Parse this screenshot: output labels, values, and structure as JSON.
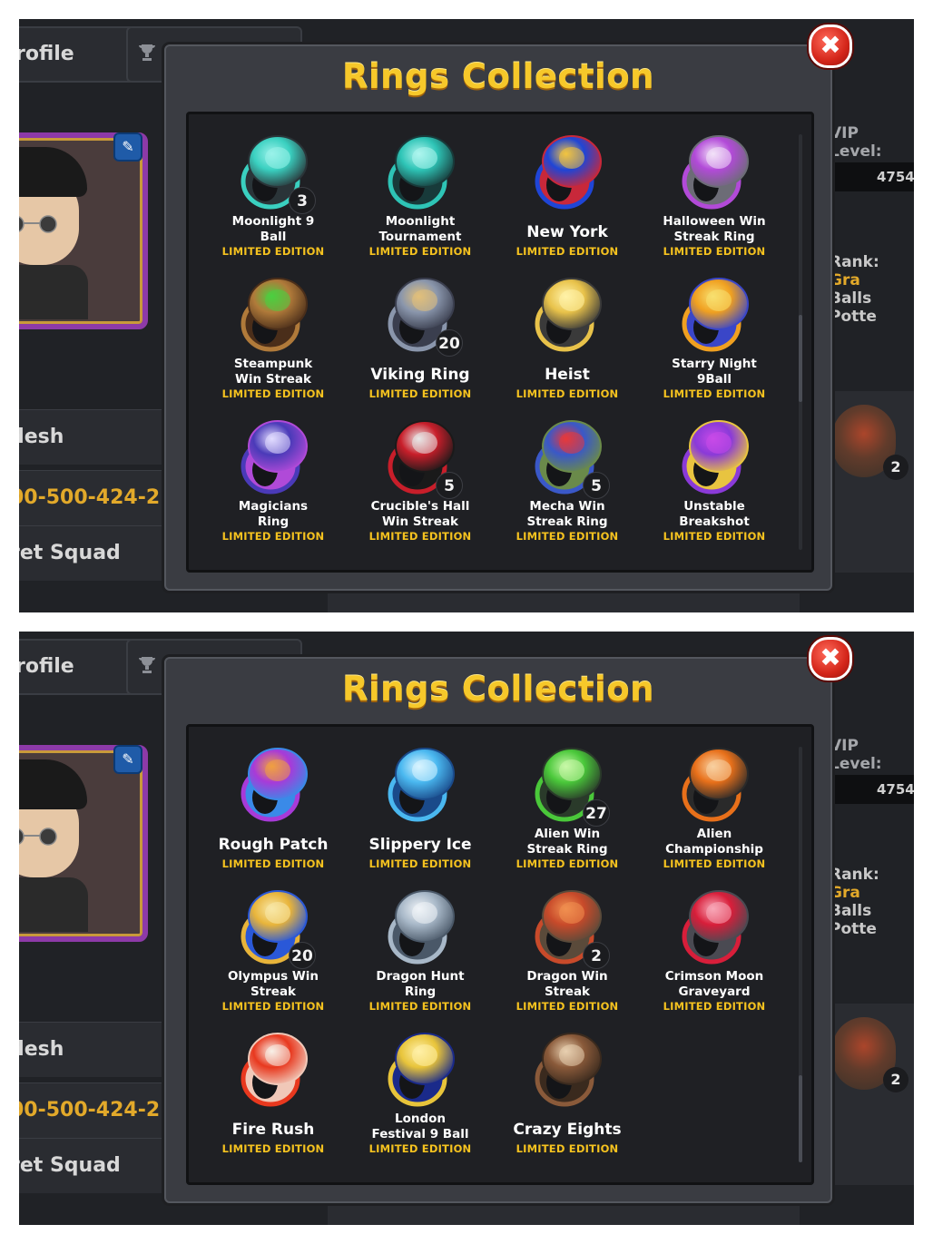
{
  "panels": [
    {
      "background": {
        "profile_tab": "rofile",
        "name": "desh",
        "id": "00-500-424-2",
        "squad": "ret Squad",
        "vip_label": "VIP Level:",
        "vip_value": "4754",
        "rank_label": "Rank:",
        "rank_value": "Gra",
        "balls_label": "Balls Potte",
        "side_ring_count": "2"
      },
      "modal": {
        "title": "Rings Collection",
        "close_icon": "close-icon",
        "scroll_position": 0.55
      },
      "rings": [
        {
          "name": "Moonlight 9 Ball",
          "lines": [
            "Moonlight 9",
            "Ball"
          ],
          "edition": "LIMITED EDITION",
          "count": "3",
          "colors": [
            "#3ad0c0",
            "#2a3438",
            "#9af2ea"
          ]
        },
        {
          "name": "Moonlight Tournament",
          "lines": [
            "Moonlight",
            "Tournament"
          ],
          "edition": "LIMITED EDITION",
          "count": "",
          "colors": [
            "#2ec4b6",
            "#183a3a",
            "#aef5ee"
          ]
        },
        {
          "name": "New York",
          "lines": [
            "New York"
          ],
          "edition": "LIMITED EDITION",
          "count": "",
          "colors": [
            "#1f45d6",
            "#c8283a",
            "#f2c440"
          ]
        },
        {
          "name": "Halloween Win Streak Ring",
          "lines": [
            "Halloween Win",
            "Streak Ring"
          ],
          "edition": "LIMITED EDITION",
          "count": "",
          "colors": [
            "#b24ad8",
            "#6c6c76",
            "#f2e2f8"
          ]
        },
        {
          "name": "Steampunk Win Streak",
          "lines": [
            "Steampunk",
            "Win Streak"
          ],
          "edition": "LIMITED EDITION",
          "count": "",
          "colors": [
            "#b07a3a",
            "#4a2e1a",
            "#4ad040"
          ]
        },
        {
          "name": "Viking Ring",
          "lines": [
            "Viking Ring"
          ],
          "edition": "LIMITED EDITION",
          "count": "20",
          "colors": [
            "#8a96ac",
            "#3a3e4e",
            "#e2c07a"
          ]
        },
        {
          "name": "Heist",
          "lines": [
            "Heist"
          ],
          "edition": "LIMITED EDITION",
          "count": "",
          "colors": [
            "#e8c24a",
            "#3a3a3a",
            "#fff2a8"
          ]
        },
        {
          "name": "Starry Night 9Ball",
          "lines": [
            "Starry Night",
            "9Ball"
          ],
          "edition": "LIMITED EDITION",
          "count": "",
          "colors": [
            "#f0a020",
            "#3a46c8",
            "#f8e070"
          ]
        },
        {
          "name": "Magicians Ring",
          "lines": [
            "Magicians",
            "Ring"
          ],
          "edition": "LIMITED EDITION",
          "count": "",
          "colors": [
            "#4a3ab8",
            "#b04ad8",
            "#e2dcff"
          ]
        },
        {
          "name": "Crucible's Hall Win Streak",
          "lines": [
            "Crucible's Hall",
            "Win Streak"
          ],
          "edition": "LIMITED EDITION",
          "count": "5",
          "colors": [
            "#c81e2a",
            "#1a1a1a",
            "#e8e8e8"
          ]
        },
        {
          "name": "Mecha Win Streak Ring",
          "lines": [
            "Mecha Win",
            "Streak Ring"
          ],
          "edition": "LIMITED EDITION",
          "count": "5",
          "colors": [
            "#3a58c8",
            "#6a8a4a",
            "#e8383a"
          ]
        },
        {
          "name": "Unstable Breakshot",
          "lines": [
            "Unstable",
            "Breakshot"
          ],
          "edition": "LIMITED EDITION",
          "count": "",
          "colors": [
            "#8a3ad8",
            "#e8c440",
            "#c84ae8"
          ]
        }
      ]
    },
    {
      "background": {
        "profile_tab": "rofile",
        "name": "desh",
        "id": "00-500-424-2",
        "squad": "ret Squad",
        "vip_label": "VIP Level:",
        "vip_value": "4754",
        "rank_label": "Rank:",
        "rank_value": "Gra",
        "balls_label": "Balls Potte",
        "side_ring_count": "2"
      },
      "modal": {
        "title": "Rings Collection",
        "close_icon": "close-icon",
        "scroll_position": 1.0
      },
      "rings": [
        {
          "name": "Rough Patch",
          "lines": [
            "Rough Patch"
          ],
          "edition": "LIMITED EDITION",
          "count": "",
          "colors": [
            "#a83ad8",
            "#3a8ae8",
            "#f0a040"
          ]
        },
        {
          "name": "Slippery Ice",
          "lines": [
            "Slippery Ice"
          ],
          "edition": "LIMITED EDITION",
          "count": "",
          "colors": [
            "#4ab8f0",
            "#1a4a8a",
            "#d8f4ff"
          ]
        },
        {
          "name": "Alien Win Streak Ring",
          "lines": [
            "Alien Win",
            "Streak Ring"
          ],
          "edition": "LIMITED EDITION",
          "count": "27",
          "colors": [
            "#4ac83a",
            "#2a3a2a",
            "#c8f8a8"
          ]
        },
        {
          "name": "Alien Championship",
          "lines": [
            "Alien",
            "Championship"
          ],
          "edition": "LIMITED EDITION",
          "count": "",
          "colors": [
            "#e8701a",
            "#2a2a2a",
            "#f8d0a0"
          ]
        },
        {
          "name": "Olympus Win Streak",
          "lines": [
            "Olympus Win",
            "Streak"
          ],
          "edition": "LIMITED EDITION",
          "count": "20",
          "colors": [
            "#e8b43a",
            "#2a58d8",
            "#f8e8a8"
          ]
        },
        {
          "name": "Dragon Hunt Ring",
          "lines": [
            "Dragon Hunt",
            "Ring"
          ],
          "edition": "LIMITED EDITION",
          "count": "",
          "colors": [
            "#a8b8c8",
            "#4a5868",
            "#f0f4f8"
          ]
        },
        {
          "name": "Dragon Win Streak",
          "lines": [
            "Dragon Win",
            "Streak"
          ],
          "edition": "LIMITED EDITION",
          "count": "2",
          "colors": [
            "#c84a2a",
            "#5a4a3a",
            "#f09050"
          ]
        },
        {
          "name": "Crimson Moon Graveyard",
          "lines": [
            "Crimson Moon",
            "Graveyard"
          ],
          "edition": "LIMITED EDITION",
          "count": "",
          "colors": [
            "#d81e3a",
            "#4a4a52",
            "#f8a8b8"
          ]
        },
        {
          "name": "Fire Rush",
          "lines": [
            "Fire Rush"
          ],
          "edition": "LIMITED EDITION",
          "count": "",
          "colors": [
            "#e8381e",
            "#f0c8b8",
            "#f8f0e8"
          ]
        },
        {
          "name": "London Festival 9 Ball",
          "lines": [
            "London",
            "Festival 9 Ball"
          ],
          "edition": "LIMITED EDITION",
          "count": "",
          "colors": [
            "#e8c43a",
            "#1a2a8a",
            "#fff0a8"
          ]
        },
        {
          "name": "Crazy Eights",
          "lines": [
            "Crazy Eights"
          ],
          "edition": "LIMITED EDITION",
          "count": "",
          "colors": [
            "#8a5a3a",
            "#3a2a1e",
            "#e8d0b0"
          ]
        }
      ]
    }
  ]
}
